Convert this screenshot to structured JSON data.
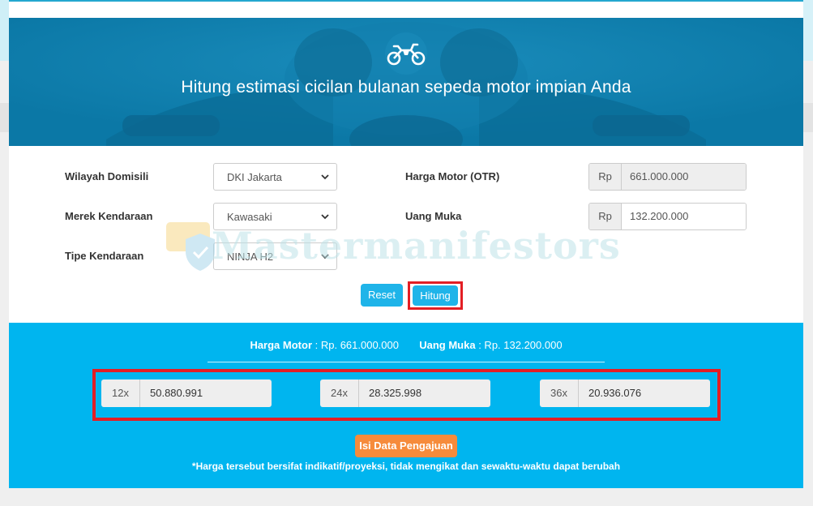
{
  "hero": {
    "title": "Hitung estimasi cicilan bulanan sepeda motor impian Anda",
    "icon": "motorcycle-icon"
  },
  "form": {
    "region": {
      "label": "Wilayah Domisili",
      "value": "DKI Jakarta"
    },
    "brand": {
      "label": "Merek Kendaraan",
      "value": "Kawasaki"
    },
    "type": {
      "label": "Tipe Kendaraan",
      "value": "NINJA H2"
    },
    "price": {
      "label": "Harga Motor (OTR)",
      "prefix": "Rp",
      "value": "661.000.000"
    },
    "down_payment": {
      "label": "Uang Muka",
      "prefix": "Rp",
      "value": "132.200.000"
    }
  },
  "buttons": {
    "reset": "Reset",
    "calculate": "Hitung"
  },
  "watermark": {
    "text": "Mastermanifestors"
  },
  "result": {
    "price_label": "Harga Motor",
    "price_value": ": Rp. 661.000.000",
    "dp_label": "Uang Muka",
    "dp_value": ": Rp. 132.200.000",
    "tenors": [
      {
        "term": "12x",
        "amount": "50.880.991"
      },
      {
        "term": "24x",
        "amount": "28.325.998"
      },
      {
        "term": "36x",
        "amount": "20.936.076"
      }
    ],
    "apply_button": "Isi Data Pengajuan",
    "note": "*Harga tersebut bersifat indikatif/proyeksi, tidak mengikat dan sewaktu-waktu dapat berubah"
  },
  "colors": {
    "hero_bg": "#0b78a6",
    "result_bg": "#00b5ef",
    "button_blue": "#1fb4e9",
    "button_orange": "#f68b3b",
    "highlight_red": "#e31e24"
  }
}
